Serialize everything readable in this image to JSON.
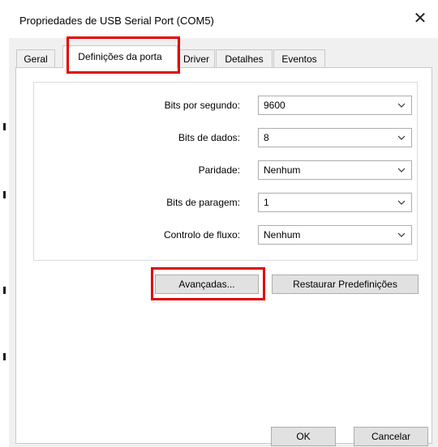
{
  "window": {
    "title": "Propriedades de USB Serial Port (COM5)",
    "close_glyph": "✕"
  },
  "tabs": [
    {
      "label": "Geral"
    },
    {
      "label": "Definições da porta"
    },
    {
      "label": "Driver"
    },
    {
      "label": "Detalhes"
    },
    {
      "label": "Eventos"
    }
  ],
  "settings": {
    "baud_label": "Bits por segundo:",
    "baud_value": "9600",
    "data_bits_label": "Bits de dados:",
    "data_bits_value": "8",
    "parity_label": "Paridade:",
    "parity_value": "Nenhum",
    "stop_bits_label": "Bits de paragem:",
    "stop_bits_value": "1",
    "flow_label": "Controlo de fluxo:",
    "flow_value": "Nenhum"
  },
  "buttons": {
    "advanced": "Avançadas...",
    "restore": "Restaurar Predefinições",
    "ok": "OK",
    "cancel": "Cancelar"
  },
  "colors": {
    "highlight": "#e30000"
  }
}
